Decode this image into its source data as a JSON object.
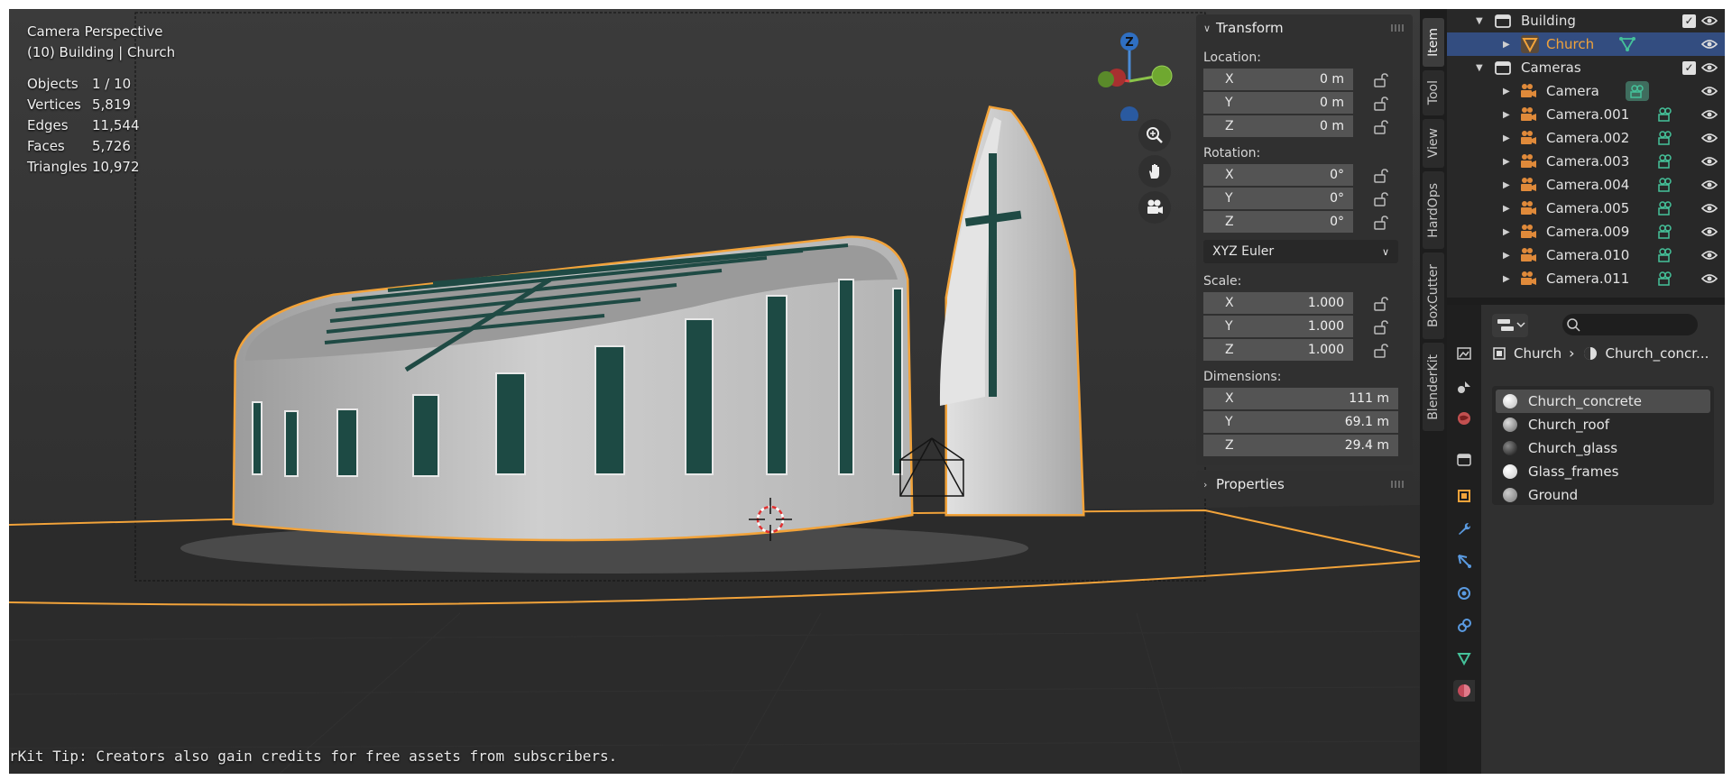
{
  "viewport": {
    "view_title": "Camera Perspective",
    "view_subtitle": "(10) Building | Church",
    "stats": [
      {
        "label": "Objects",
        "value": "1 / 10"
      },
      {
        "label": "Vertices",
        "value": "5,819"
      },
      {
        "label": "Edges",
        "value": "11,544"
      },
      {
        "label": "Faces",
        "value": "5,726"
      },
      {
        "label": "Triangles",
        "value": "10,972"
      }
    ],
    "tip": "rKit Tip: Creators also gain credits for free assets from subscribers.",
    "gizmo_label": "Z"
  },
  "transform": {
    "header": "Transform",
    "location": {
      "label": "Location:",
      "x": "0 m",
      "y": "0 m",
      "z": "0 m"
    },
    "rotation": {
      "label": "Rotation:",
      "x": "0°",
      "y": "0°",
      "z": "0°",
      "mode": "XYZ Euler"
    },
    "scale": {
      "label": "Scale:",
      "x": "1.000",
      "y": "1.000",
      "z": "1.000"
    },
    "dimensions": {
      "label": "Dimensions:",
      "x": "111 m",
      "y": "69.1 m",
      "z": "29.4 m"
    },
    "axis_x": "X",
    "axis_y": "Y",
    "axis_z": "Z"
  },
  "properties_panel": {
    "header": "Properties"
  },
  "tabs": [
    "Item",
    "Tool",
    "View",
    "HardOps",
    "BoxCutter",
    "BlenderKit"
  ],
  "outliner": [
    {
      "name": "Building",
      "kind": "collection"
    },
    {
      "name": "Church",
      "kind": "mesh"
    },
    {
      "name": "Cameras",
      "kind": "collection"
    },
    {
      "name": "Camera",
      "kind": "camera"
    },
    {
      "name": "Camera.001",
      "kind": "camera"
    },
    {
      "name": "Camera.002",
      "kind": "camera"
    },
    {
      "name": "Camera.003",
      "kind": "camera"
    },
    {
      "name": "Camera.004",
      "kind": "camera"
    },
    {
      "name": "Camera.005",
      "kind": "camera"
    },
    {
      "name": "Camera.009",
      "kind": "camera"
    },
    {
      "name": "Camera.010",
      "kind": "camera"
    },
    {
      "name": "Camera.011",
      "kind": "camera"
    }
  ],
  "material": {
    "breadcrumb_object": "Church",
    "breadcrumb_material": "Church_concr...",
    "slots": [
      "Church_concrete",
      "Church_roof",
      "Church_glass",
      "Glass_frames",
      "Ground"
    ]
  },
  "colors": {
    "accent_orange": "#f2a33a",
    "selection_blue": "#334d80",
    "camera_green": "#45c29a"
  }
}
